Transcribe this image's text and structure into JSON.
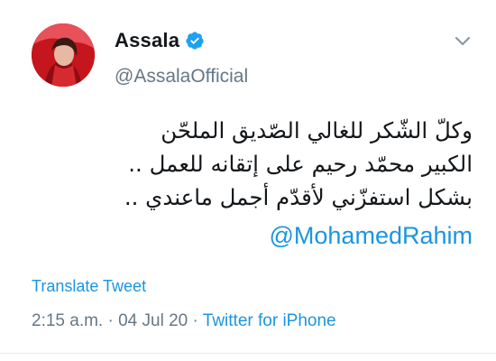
{
  "tweet": {
    "author": {
      "display_name": "Assala",
      "handle": "@AssalaOfficial",
      "verified_icon": "verified-badge-icon",
      "avatar_icon": "avatar"
    },
    "menu_icon": "chevron-down-icon",
    "text_lines": [
      "وكلّ الشّكر للغالي الصّديق الملحّن",
      "الكبير محمّد رحيم على إتقانه للعمل ..",
      "بشكل استفزّني لأقدّم أجمل ماعندي .."
    ],
    "mention": "@MohamedRahim",
    "translate_label": "Translate Tweet",
    "time": "2:15 a.m.",
    "separator": "·",
    "date": "04 Jul 20",
    "source": "Twitter for iPhone"
  },
  "colors": {
    "accent": "#1b95e0",
    "text_primary": "#14171a",
    "text_secondary": "#657786",
    "verified": "#1da1f2"
  }
}
